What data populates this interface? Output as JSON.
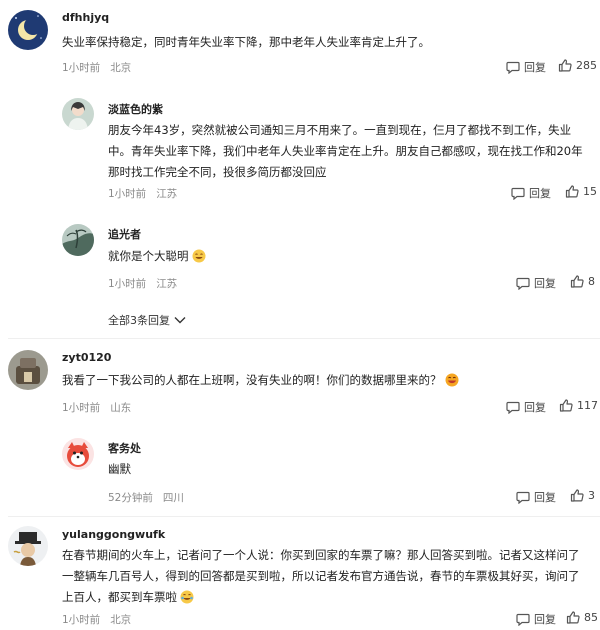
{
  "comments": [
    {
      "user": "dfhhjyq",
      "lines": [
        "失业率保持稳定，同时青年失业率下降，那中老年人失业率肯定上升了。"
      ],
      "time": "1小时前",
      "location": "北京",
      "reply_label": "回复",
      "likes": "285"
    },
    {
      "user": "zyt0120",
      "lines": [
        "我看了一下我公司的人都在上班啊，没有失业的啊！你们的数据哪里来的？"
      ],
      "time": "1小时前",
      "location": "山东",
      "reply_label": "回复",
      "likes": "117"
    },
    {
      "user": "yulanggongwufk",
      "lines": [
        "在春节期间的火车上，记者问了一个人说：你买到回家的车票了嘛？那人回答买到啦。记者又这样问了",
        "一整辆车几百号人，得到的回答都是买到啦，所以记者发布官方通告说，春节的车票极其好买，询问了",
        "上百人，都买到车票啦"
      ],
      "time": "1小时前",
      "location": "北京",
      "reply_label": "回复",
      "likes": "85"
    }
  ],
  "replies": [
    {
      "user": "淡蓝色的紫",
      "lines": [
        "朋友今年43岁，突然就被公司通知三月不用来了。一直到现在，仨月了都找不到工作，失业",
        "中。青年失业率下降，我们中老年人失业率肯定在上升。朋友自己都感叹，现在找工作和20年",
        "那时找工作完全不同，投很多简历都没回应"
      ],
      "time": "1小时前",
      "location": "江苏",
      "reply_label": "回复",
      "likes": "15"
    },
    {
      "user": "追光者",
      "lines": [
        "就你是个大聪明"
      ],
      "time": "1小时前",
      "location": "江苏",
      "reply_label": "回复",
      "likes": "8"
    },
    {
      "user": "客务处",
      "lines": [
        "幽默"
      ],
      "time": "52分钟前",
      "location": "四川",
      "reply_label": "回复",
      "likes": "3"
    }
  ],
  "expand_replies_label": "全部3条回复",
  "colors": {
    "meta": "#8a8a8a",
    "text": "#222222",
    "divider": "#efefef"
  }
}
